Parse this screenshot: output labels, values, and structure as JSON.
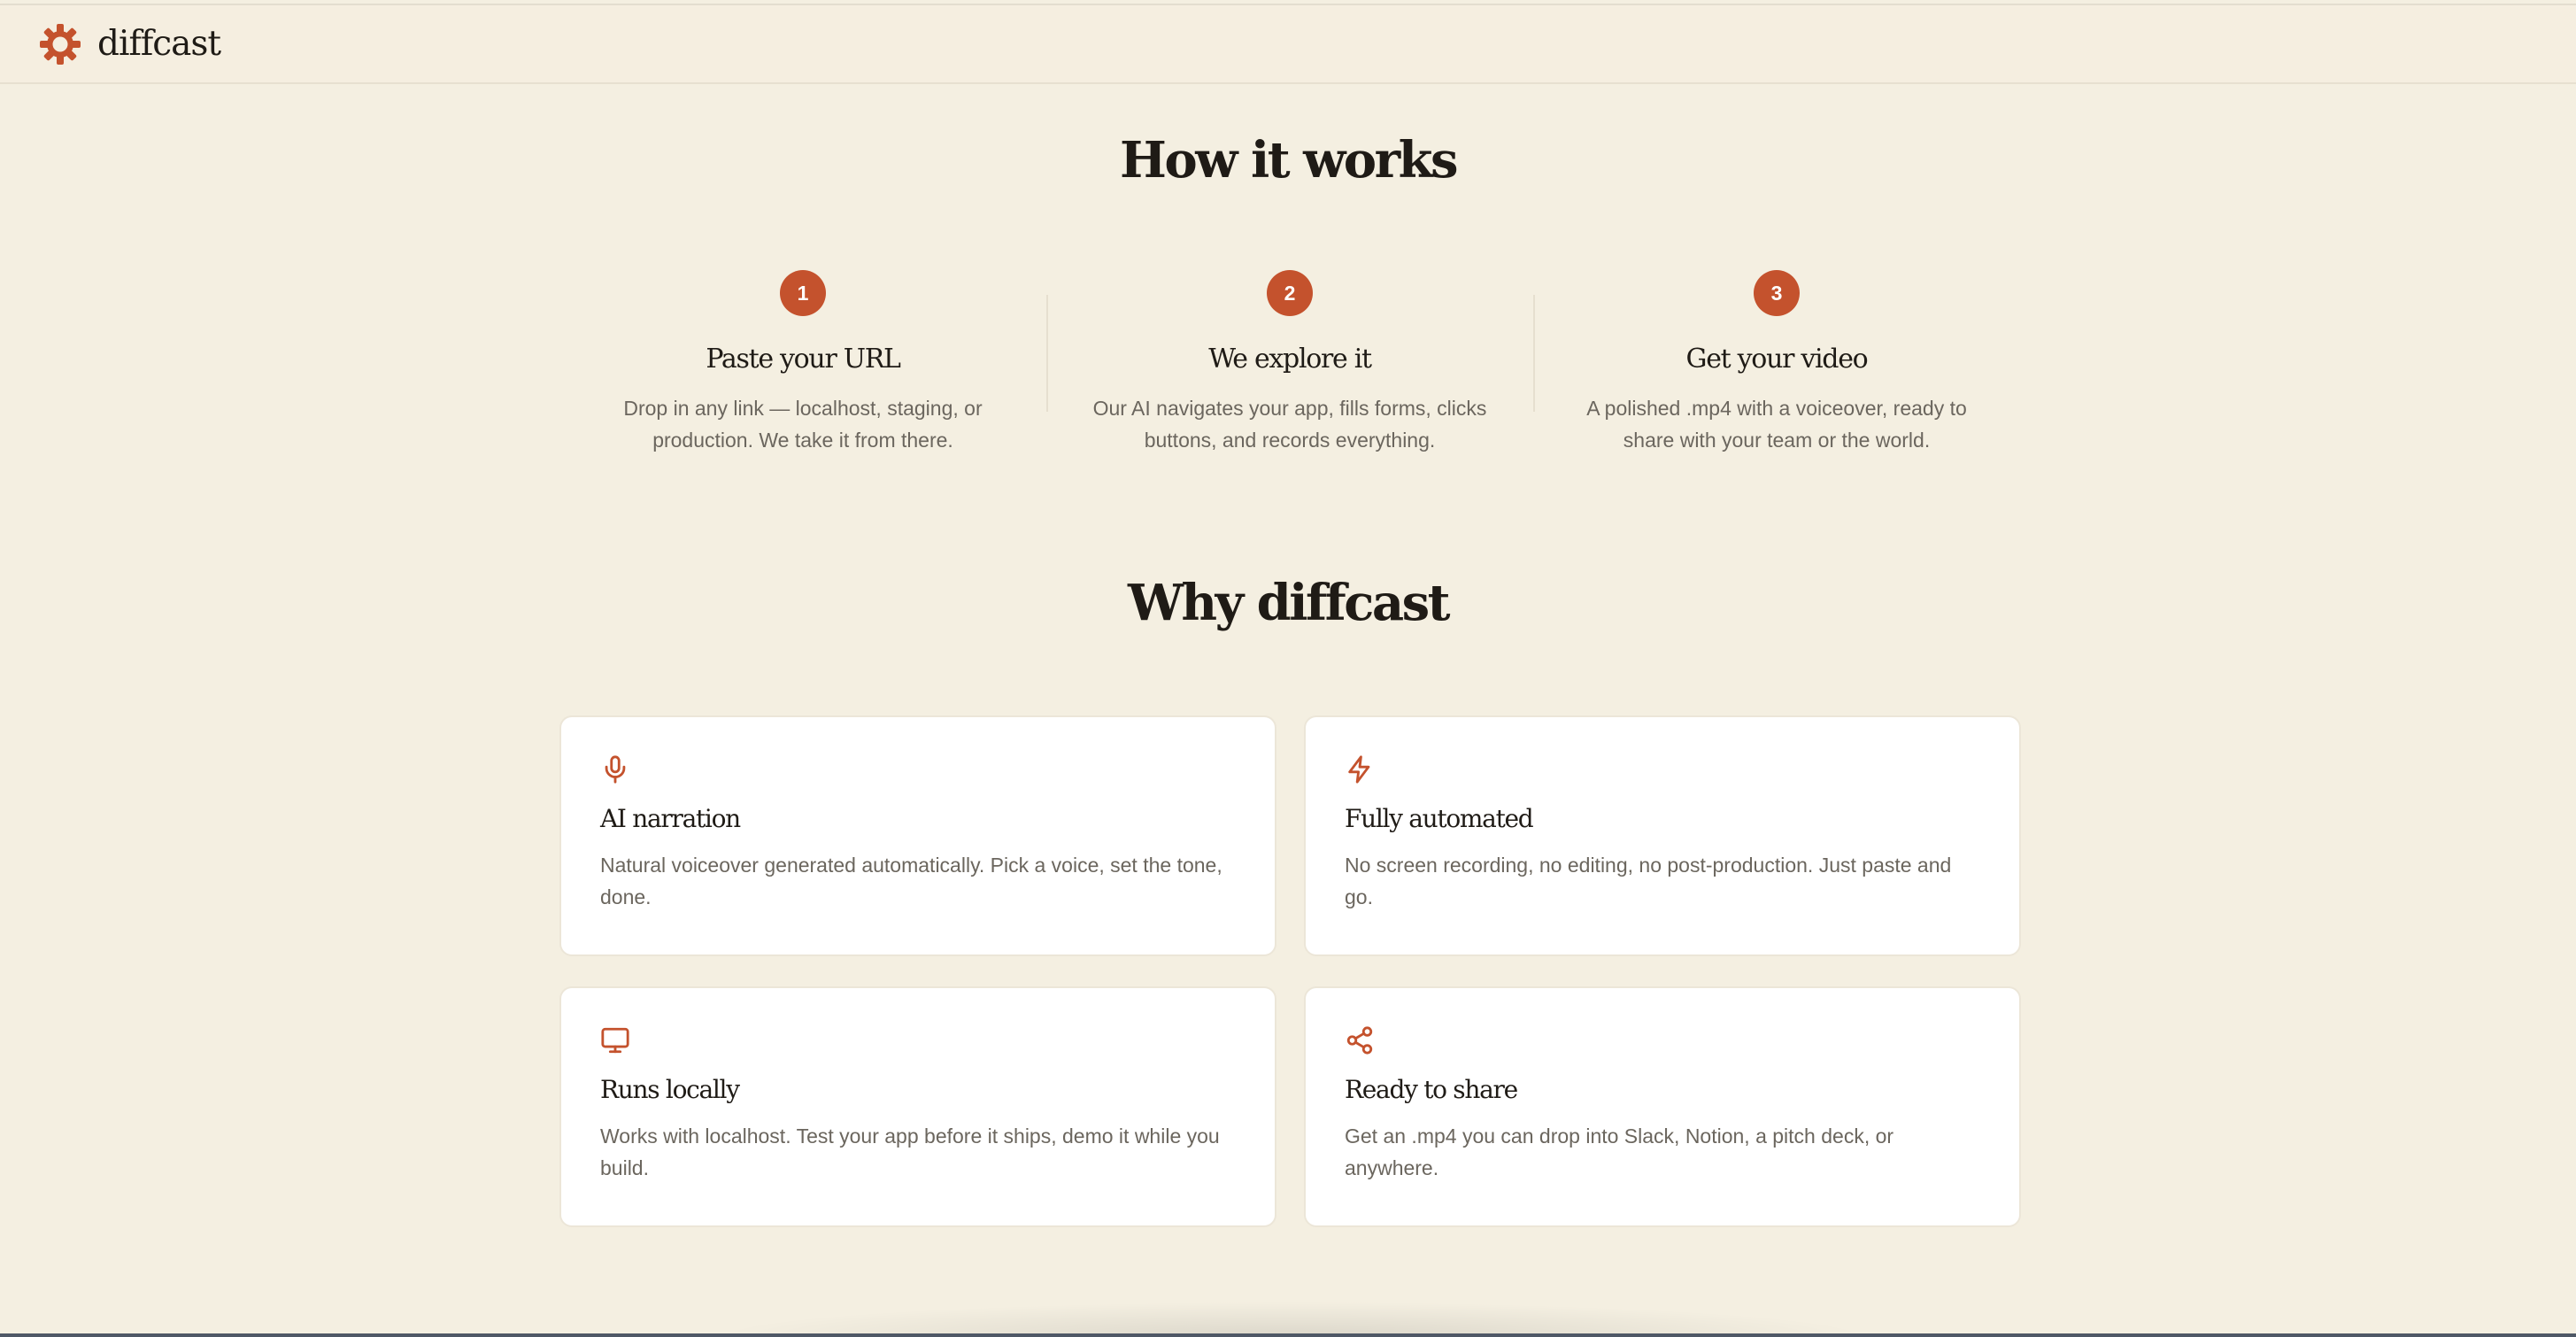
{
  "header": {
    "brand": "diffcast",
    "logo_icon": "sunburst-logo-icon"
  },
  "how_it_works": {
    "title": "How it works",
    "steps": [
      {
        "number": "1",
        "title": "Paste your URL",
        "description": "Drop in any link — localhost, staging, or production. We take it from there."
      },
      {
        "number": "2",
        "title": "We explore it",
        "description": "Our AI navigates your app, fills forms, clicks buttons, and records everything."
      },
      {
        "number": "3",
        "title": "Get your video",
        "description": "A polished .mp4 with a voiceover, ready to share with your team or the world."
      }
    ]
  },
  "why": {
    "title": "Why diffcast",
    "features": [
      {
        "icon": "microphone-icon",
        "title": "AI narration",
        "description": "Natural voiceover generated automatically. Pick a voice, set the tone, done."
      },
      {
        "icon": "lightning-icon",
        "title": "Fully automated",
        "description": "No screen recording, no editing, no post-production. Just paste and go."
      },
      {
        "icon": "monitor-icon",
        "title": "Runs locally",
        "description": "Works with localhost. Test your app before it ships, demo it while you build."
      },
      {
        "icon": "share-icon",
        "title": "Ready to share",
        "description": "Get an .mp4 you can drop into Slack, Notion, a pitch deck, or anywhere."
      }
    ]
  },
  "colors": {
    "accent": "#c4522d",
    "background": "#f4efe1",
    "card": "#ffffff",
    "text": "#1f1b16",
    "muted_text": "#6b665e"
  }
}
